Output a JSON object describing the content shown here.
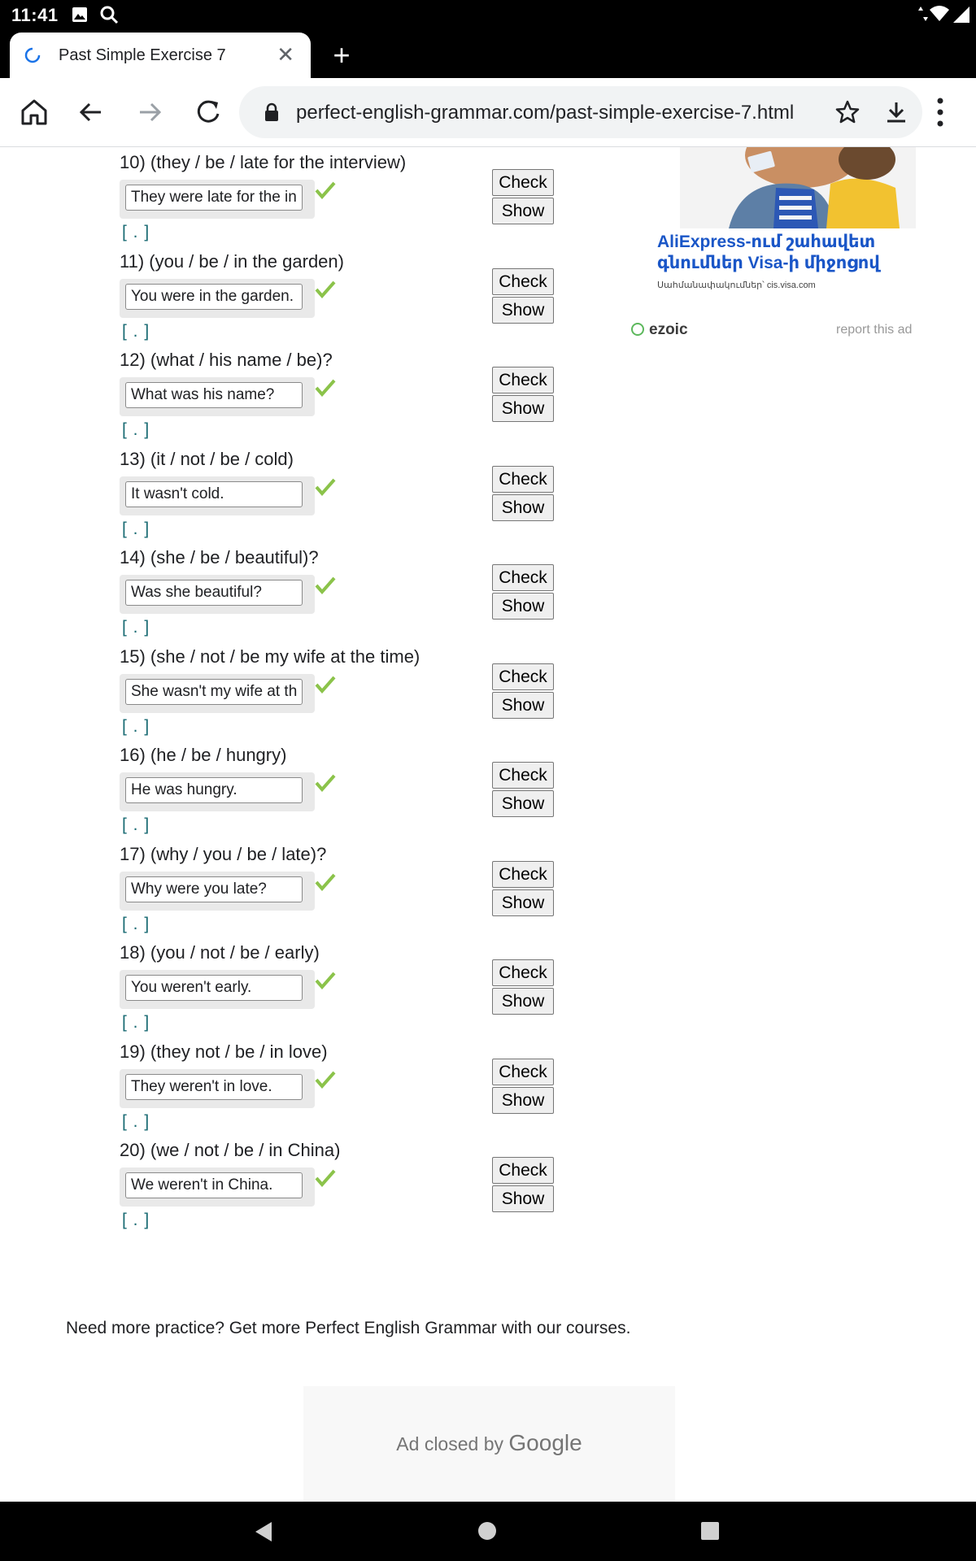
{
  "status_bar": {
    "time": "11:41"
  },
  "tab": {
    "title": "Past Simple Exercise 7"
  },
  "address_bar": {
    "url": "perfect-english-grammar.com/past-simple-exercise-7.html"
  },
  "questions": [
    {
      "label": "10) (they / be / late for the interview)",
      "answer": "They were late for the interview.",
      "brackets": "[ . ]"
    },
    {
      "label": "11) (you / be / in the garden)",
      "answer": "You were in the garden.",
      "brackets": "[ . ]"
    },
    {
      "label": "12) (what / his name / be)?",
      "answer": "What was his name?",
      "brackets": "[ . ]"
    },
    {
      "label": "13) (it / not / be / cold)",
      "answer": "It wasn't cold.",
      "brackets": "[ . ]"
    },
    {
      "label": "14) (she / be / beautiful)?",
      "answer": "Was she beautiful?",
      "brackets": "[ . ]"
    },
    {
      "label": "15) (she / not / be my wife at the time)",
      "answer": "She wasn't my wife at the time.",
      "brackets": "[ . ]"
    },
    {
      "label": "16) (he / be / hungry)",
      "answer": "He was hungry.",
      "brackets": "[ . ]"
    },
    {
      "label": "17) (why / you / be / late)?",
      "answer": "Why were you late?",
      "brackets": "[ . ]"
    },
    {
      "label": "18) (you / not / be / early)",
      "answer": "You weren't early.",
      "brackets": "[ . ]"
    },
    {
      "label": "19) (they not / be / in love)",
      "answer": "They weren't in love.",
      "brackets": "[ . ]"
    },
    {
      "label": "20) (we / not / be / in China)",
      "answer": "We weren't in China.",
      "brackets": "[ . ]"
    }
  ],
  "buttons": {
    "check": "Check",
    "show": "Show"
  },
  "ad_top": {
    "headline": "AliExpress-ում շահավետ գնումներ Visa-ի միջոցով",
    "sub": "Սահմանափակումներ՝ cis.visa.com",
    "ezoic": "ezoic",
    "report": "report this ad"
  },
  "footer": {
    "practice_text": "Need more practice? Get more Perfect English Grammar with our courses.",
    "ad_closed_prefix": "Ad closed by",
    "ad_closed_brand": "Google"
  },
  "colors": {
    "check_mark": "#8bc34a",
    "brackets": "#1a6b73",
    "ad_headline": "#1a56c7"
  }
}
